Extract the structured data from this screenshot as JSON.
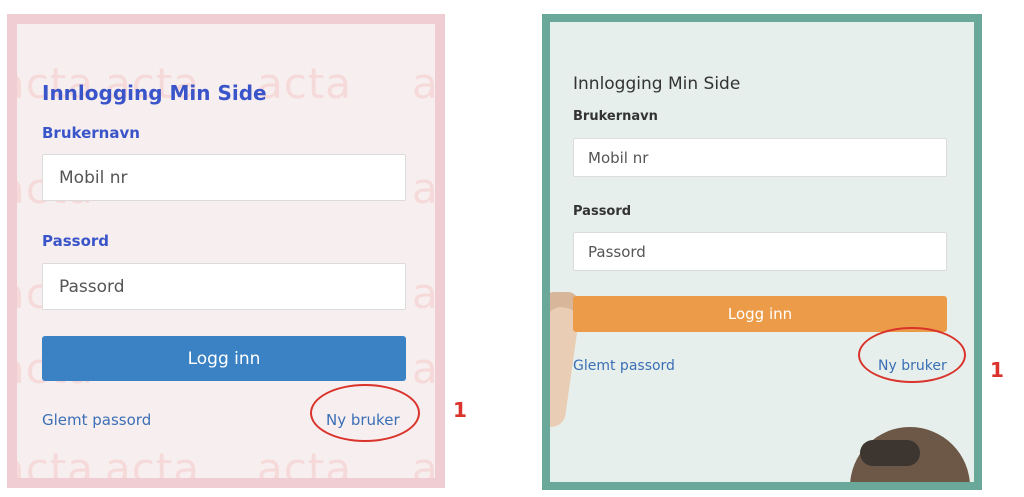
{
  "left_form": {
    "title": "Innlogging Min Side",
    "username_label": "Brukernavn",
    "username_placeholder": "Mobil nr",
    "password_label": "Passord",
    "password_placeholder": "Passord",
    "login_button": "Logg inn",
    "forgot_link": "Glemt passord",
    "new_user_link": "Ny bruker",
    "watermark_text": "acta",
    "accent_color": "#3a55c9",
    "button_color": "#3a82c4",
    "border_color": "#efcdd3"
  },
  "right_form": {
    "title": "Innlogging Min Side",
    "username_label": "Brukernavn",
    "username_placeholder": "Mobil nr",
    "password_label": "Passord",
    "password_placeholder": "Passord",
    "login_button": "Logg inn",
    "forgot_link": "Glemt passord",
    "new_user_link": "Ny bruker",
    "button_color": "#ec9b48",
    "border_color": "#6aa999"
  },
  "annotations": {
    "left_marker": "1",
    "right_marker": "1",
    "color": "#d9332b"
  }
}
